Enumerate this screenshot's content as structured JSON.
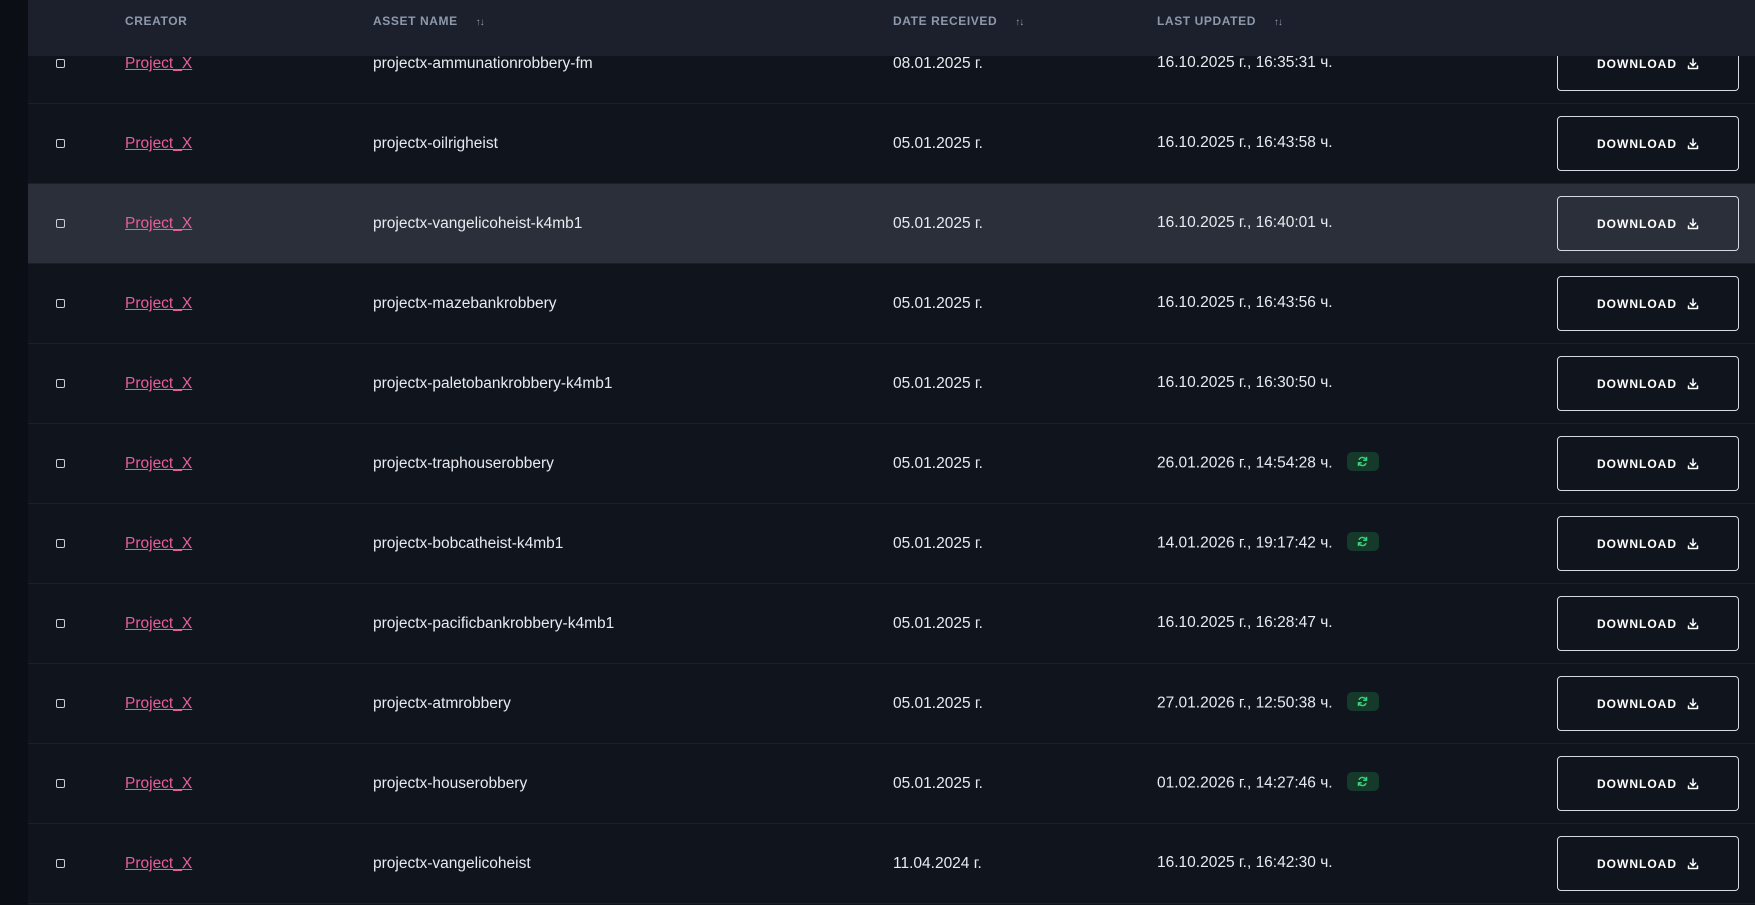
{
  "table": {
    "headers": {
      "creator": "CREATOR",
      "asset_name": "ASSET NAME",
      "date_received": "DATE RECEIVED",
      "last_updated": "LAST UPDATED"
    },
    "download_label": "DOWNLOAD",
    "rows": [
      {
        "creator": "Project_X",
        "asset": "projectx-ammunationrobbery-fm",
        "date_received": "08.01.2025 г.",
        "last_updated": "16.10.2025 г., 16:35:31 ч.",
        "updated_badge": false
      },
      {
        "creator": "Project_X",
        "asset": "projectx-oilrigheist",
        "date_received": "05.01.2025 г.",
        "last_updated": "16.10.2025 г., 16:43:58 ч.",
        "updated_badge": false
      },
      {
        "creator": "Project_X",
        "asset": "projectx-vangelicoheist-k4mb1",
        "date_received": "05.01.2025 г.",
        "last_updated": "16.10.2025 г., 16:40:01 ч.",
        "updated_badge": false
      },
      {
        "creator": "Project_X",
        "asset": "projectx-mazebankrobbery",
        "date_received": "05.01.2025 г.",
        "last_updated": "16.10.2025 г., 16:43:56 ч.",
        "updated_badge": false
      },
      {
        "creator": "Project_X",
        "asset": "projectx-paletobankrobbery-k4mb1",
        "date_received": "05.01.2025 г.",
        "last_updated": "16.10.2025 г., 16:30:50 ч.",
        "updated_badge": false
      },
      {
        "creator": "Project_X",
        "asset": "projectx-traphouserobbery",
        "date_received": "05.01.2025 г.",
        "last_updated": "26.01.2026 г., 14:54:28 ч.",
        "updated_badge": true
      },
      {
        "creator": "Project_X",
        "asset": "projectx-bobcatheist-k4mb1",
        "date_received": "05.01.2025 г.",
        "last_updated": "14.01.2026 г., 19:17:42 ч.",
        "updated_badge": true
      },
      {
        "creator": "Project_X",
        "asset": "projectx-pacificbankrobbery-k4mb1",
        "date_received": "05.01.2025 г.",
        "last_updated": "16.10.2025 г., 16:28:47 ч.",
        "updated_badge": false
      },
      {
        "creator": "Project_X",
        "asset": "projectx-atmrobbery",
        "date_received": "05.01.2025 г.",
        "last_updated": "27.01.2026 г., 12:50:38 ч.",
        "updated_badge": true
      },
      {
        "creator": "Project_X",
        "asset": "projectx-houserobbery",
        "date_received": "05.01.2025 г.",
        "last_updated": "01.02.2026 г., 14:27:46 ч.",
        "updated_badge": true
      },
      {
        "creator": "Project_X",
        "asset": "projectx-vangelicoheist",
        "date_received": "11.04.2024 г.",
        "last_updated": "16.10.2025 г., 16:42:30 ч.",
        "updated_badge": false
      }
    ]
  },
  "colors": {
    "background": "#10141d",
    "header_bg": "#1b202c",
    "creator_link": "#e85d9b",
    "highlight_row": "#2b2f3a",
    "badge_bg": "#15392a",
    "badge_icon": "#3ad27a"
  },
  "icons": {
    "sort": "sort-arrows-icon",
    "download": "download-icon",
    "updated": "refresh-icon",
    "checkbox": "checkbox"
  },
  "state": {
    "hovered_row_index": 2
  }
}
